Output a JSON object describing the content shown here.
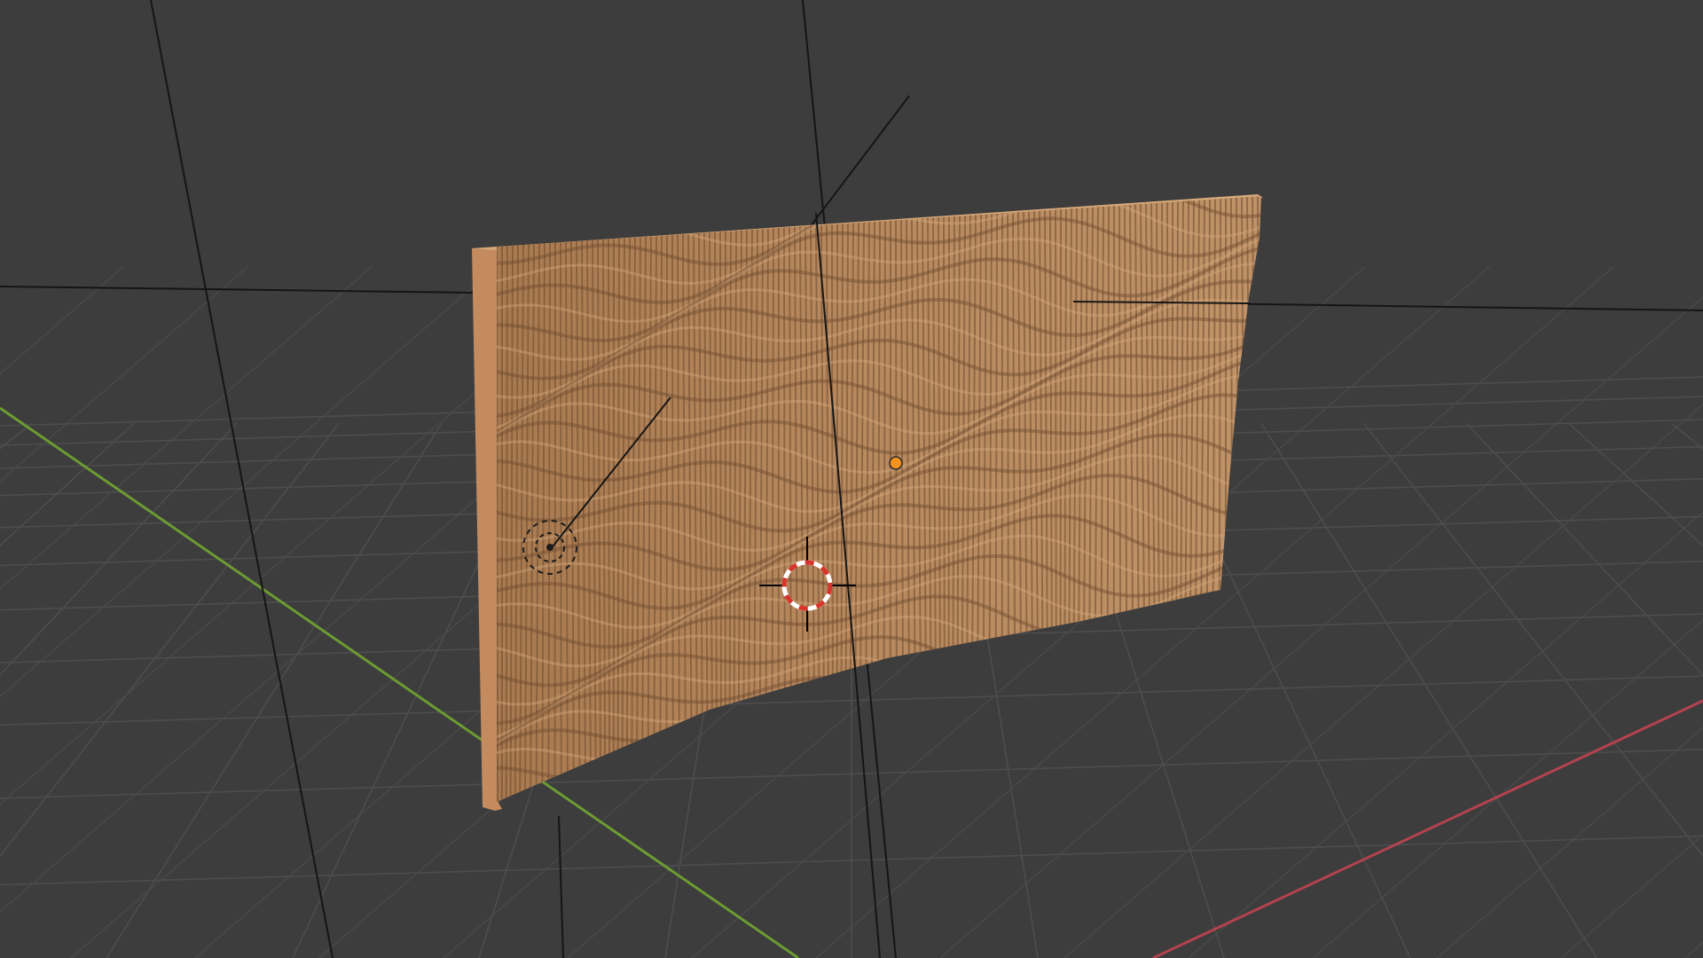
{
  "viewport": {
    "background_color": "#3d3d3d",
    "grid_color": "#4d4d4d",
    "x_axis_color": "#b3424f",
    "y_axis_color": "#6c9b33",
    "show_grid": true,
    "show_axes": true
  },
  "scene": {
    "panel_object": {
      "type": "mesh",
      "shape": "wavy slatted relief panel",
      "color": "#b08258",
      "shadow_color": "#6e4c30",
      "highlight_color": "#d7aa7c",
      "edge_color": "#c48b5f",
      "selected": false
    },
    "light_object": {
      "type": "light",
      "icon": "light-icon"
    },
    "camera_object": {
      "type": "camera",
      "icon": "camera-lines-icon"
    },
    "object_origin": {
      "icon": "origin-dot-icon",
      "color": "#f5921f"
    },
    "cursor_3d": {
      "icon": "3d-cursor-icon",
      "ring_color_a": "#ffffff",
      "ring_color_b": "#d9342b"
    }
  }
}
